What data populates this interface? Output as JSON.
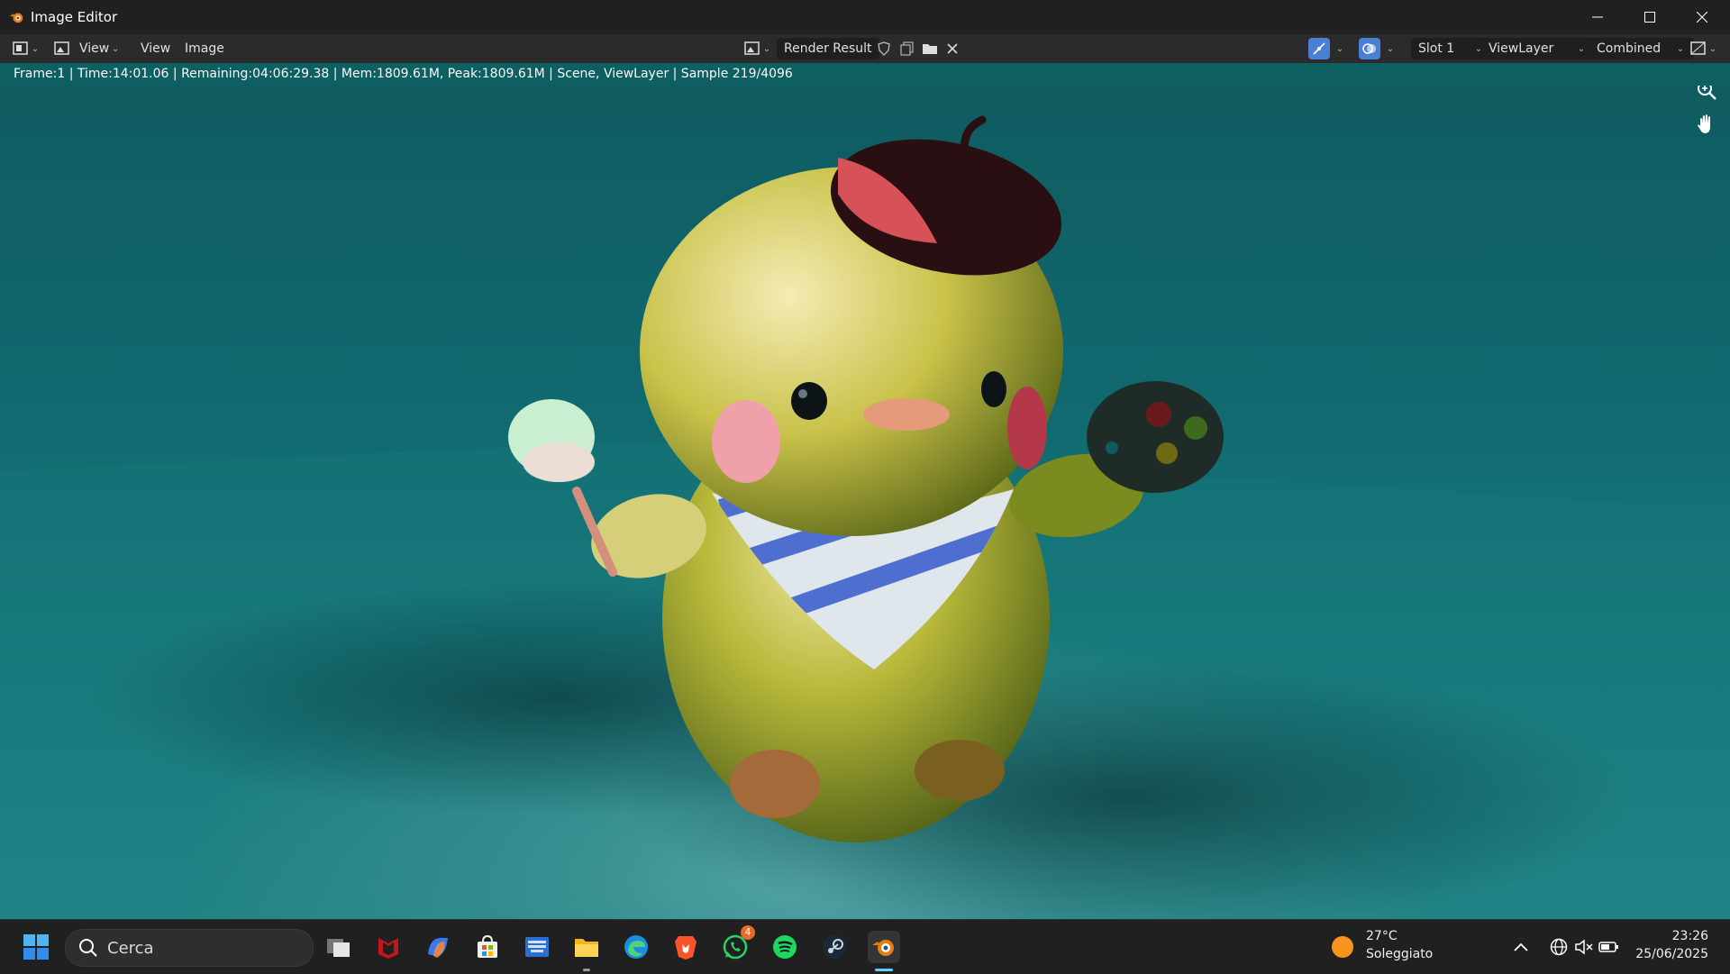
{
  "window": {
    "title": "Image Editor",
    "controls": {
      "minimize": "minimize-icon",
      "maximize": "maximize-icon",
      "close": "close-icon"
    }
  },
  "header": {
    "editor_type_icon": "image-editor-icon",
    "mode_icon": "view-mode-icon",
    "mode_label": "View",
    "menus": [
      "View",
      "Image"
    ],
    "image_name": "Render Result",
    "slot": "Slot 1",
    "view_layer": "ViewLayer",
    "pass": "Combined"
  },
  "status": {
    "text": "Frame:1 | Time:14:01.06 | Remaining:04:06:29.38 | Mem:1809.61M, Peak:1809.61M | Scene, ViewLayer | Sample 219/4096"
  },
  "taskbar": {
    "search_label": "Cerca",
    "whatsapp_badge": "4",
    "weather_temp": "27°C",
    "weather_desc": "Soleggiato",
    "time": "23:26",
    "date": "25/06/2025",
    "apps": [
      "start-icon",
      "task-view-icon",
      "mcafee-icon",
      "copilot-icon",
      "store-icon",
      "keyboard-app-icon",
      "file-explorer-icon",
      "edge-icon",
      "brave-icon",
      "whatsapp-icon",
      "spotify-icon",
      "steam-icon",
      "blender-icon"
    ]
  },
  "colors": {
    "status_bar": "#0e5f62",
    "accent_blue": "#4a7fd4",
    "blender_orange": "#e87d0d"
  }
}
